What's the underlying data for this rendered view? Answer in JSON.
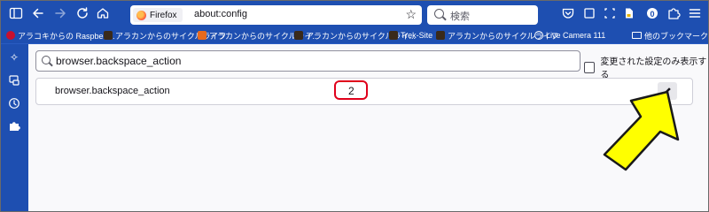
{
  "browser": {
    "identity_label": "Firefox",
    "url": "about:config",
    "search_placeholder": "検索",
    "profile_badge": "0"
  },
  "bookmarks": [
    {
      "label": "アラコキからの Raspberr...",
      "icon_color": "#c8102e"
    },
    {
      "label": "アラカンからのサイクルライフ",
      "icon_color": "#3a2a1a"
    },
    {
      "label": "アラカンからのサイクルライ...",
      "icon_color": "#e66a1f"
    },
    {
      "label": "アラカンからのサイクルライ...",
      "icon_color": "#3a2a1a"
    },
    {
      "label": "〜アラカンからのサイクル...",
      "icon_color": "#3a2a1a"
    },
    {
      "label": "Trek-Site",
      "icon_color": "#3a2a1a"
    },
    {
      "label": "アラカンからのサイクルライフ",
      "icon_color": "#3a2a1a"
    },
    {
      "label": "Live Camera 111",
      "icon_color": "#1e4fb1"
    }
  ],
  "other_bookmarks_label": "他のブックマーク",
  "config": {
    "search_value": "browser.backspace_action",
    "checkbox_label": "変更された設定のみ表示する",
    "pref_name": "browser.backspace_action",
    "pref_value": "2"
  },
  "colors": {
    "chrome_blue": "#1e4fb1",
    "highlight_red": "#e0001b",
    "arrow_yellow": "#ffff00"
  }
}
